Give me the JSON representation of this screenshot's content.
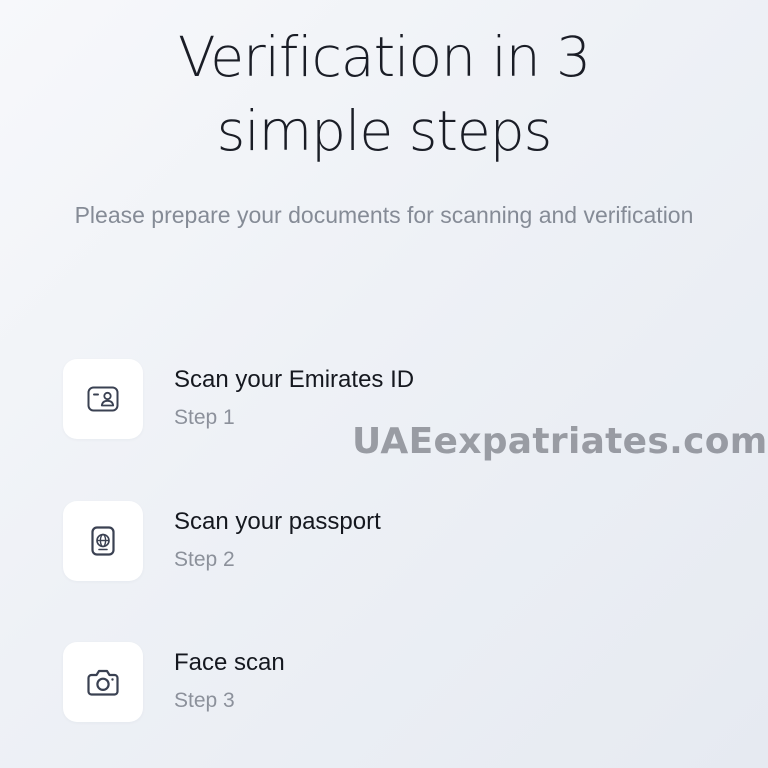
{
  "header": {
    "title_line1": "Verification in 3",
    "title_line2": "simple steps",
    "subtitle": "Please prepare your documents for scanning and verification"
  },
  "steps": [
    {
      "title": "Scan your Emirates ID",
      "subtitle": "Step 1",
      "icon": "id-card-icon"
    },
    {
      "title": "Scan your passport",
      "subtitle": "Step 2",
      "icon": "passport-icon"
    },
    {
      "title": "Face scan",
      "subtitle": "Step 3",
      "icon": "camera-icon"
    }
  ],
  "watermark": "UAEexpatriates.com",
  "colors": {
    "background": "#eef1f6",
    "card": "#ffffff",
    "icon_stroke": "#3a4152",
    "secondary_text": "#8c919b"
  }
}
